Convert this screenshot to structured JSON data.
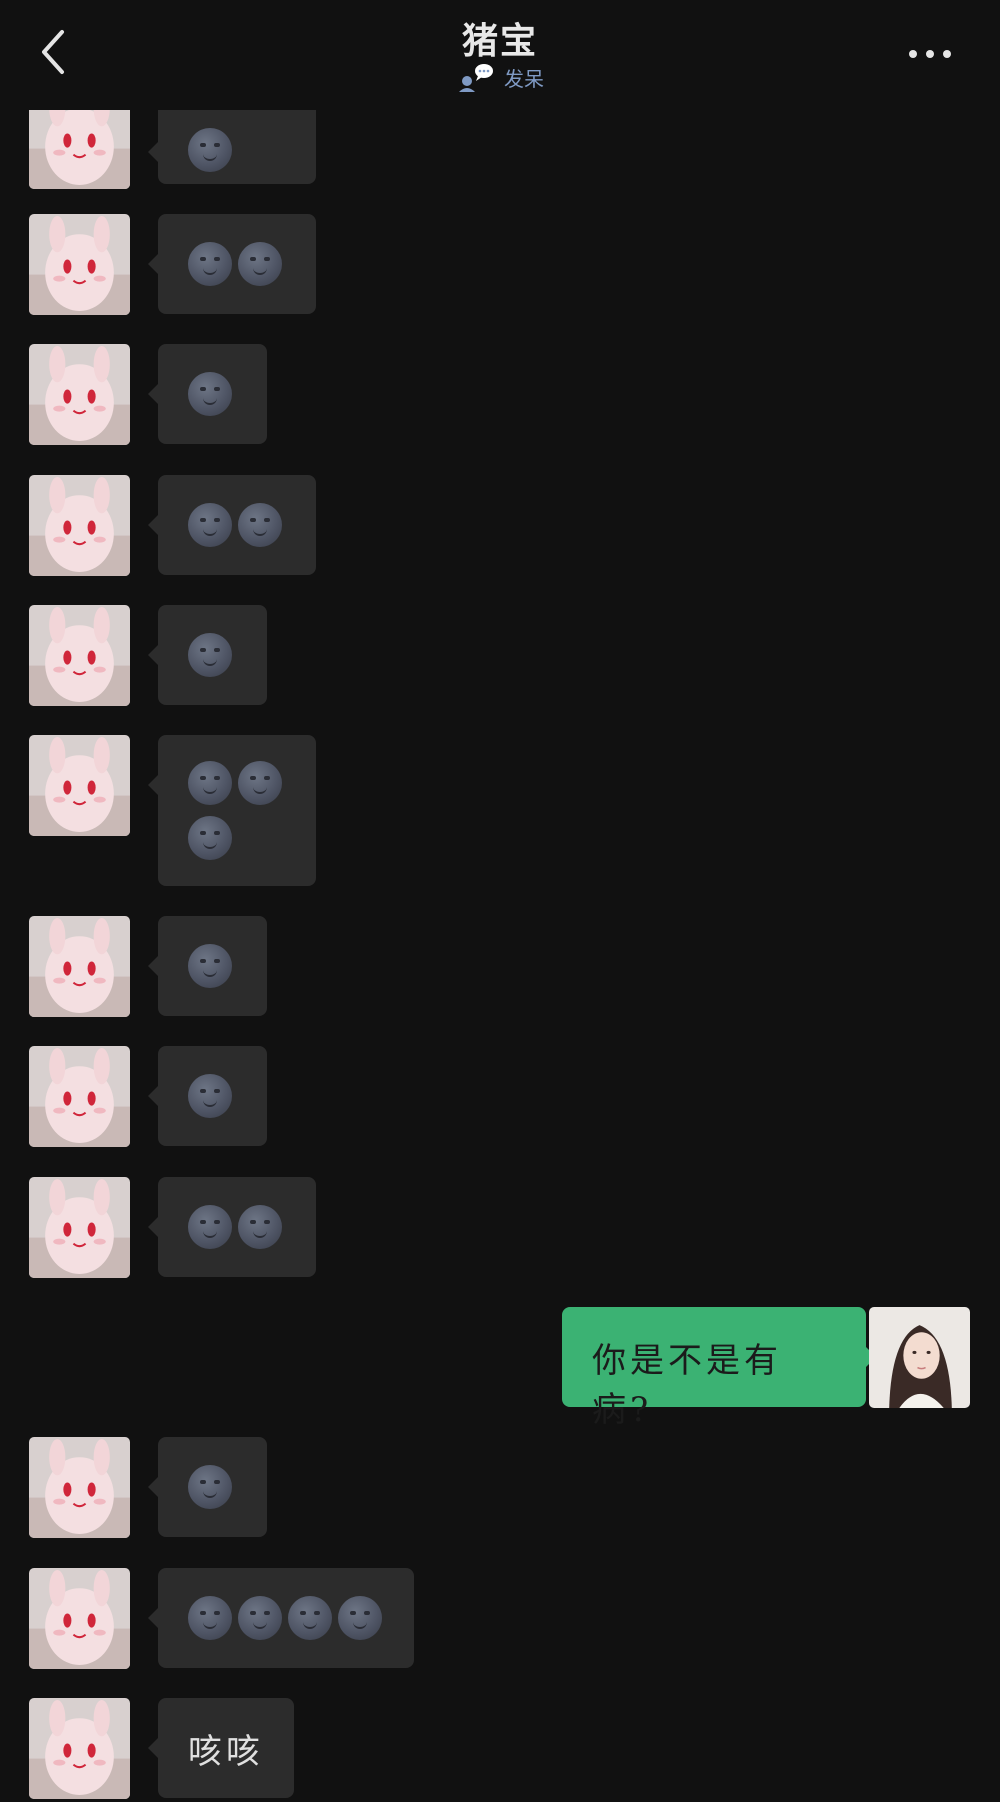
{
  "header": {
    "title": "猪宝",
    "status_text": "发呆"
  },
  "messages": [
    {
      "sender": "them",
      "type": "emoji",
      "count": 1
    },
    {
      "sender": "them",
      "type": "emoji",
      "count": 2
    },
    {
      "sender": "them",
      "type": "emoji",
      "count": 1
    },
    {
      "sender": "them",
      "type": "emoji",
      "count": 2
    },
    {
      "sender": "them",
      "type": "emoji",
      "count": 1
    },
    {
      "sender": "them",
      "type": "emoji",
      "count": 3
    },
    {
      "sender": "them",
      "type": "emoji",
      "count": 1
    },
    {
      "sender": "them",
      "type": "emoji",
      "count": 1
    },
    {
      "sender": "them",
      "type": "emoji",
      "count": 2
    },
    {
      "sender": "me",
      "type": "text",
      "text": "你是不是有病?"
    },
    {
      "sender": "them",
      "type": "emoji",
      "count": 1
    },
    {
      "sender": "them",
      "type": "emoji",
      "count": 4
    },
    {
      "sender": "them",
      "type": "text",
      "text": "咳咳"
    }
  ],
  "emoji_name": "new-moon-face",
  "colors": {
    "background": "#111111",
    "their_bubble": "#2c2c2c",
    "my_bubble": "#3bb273",
    "status": "#7f9ac4"
  }
}
